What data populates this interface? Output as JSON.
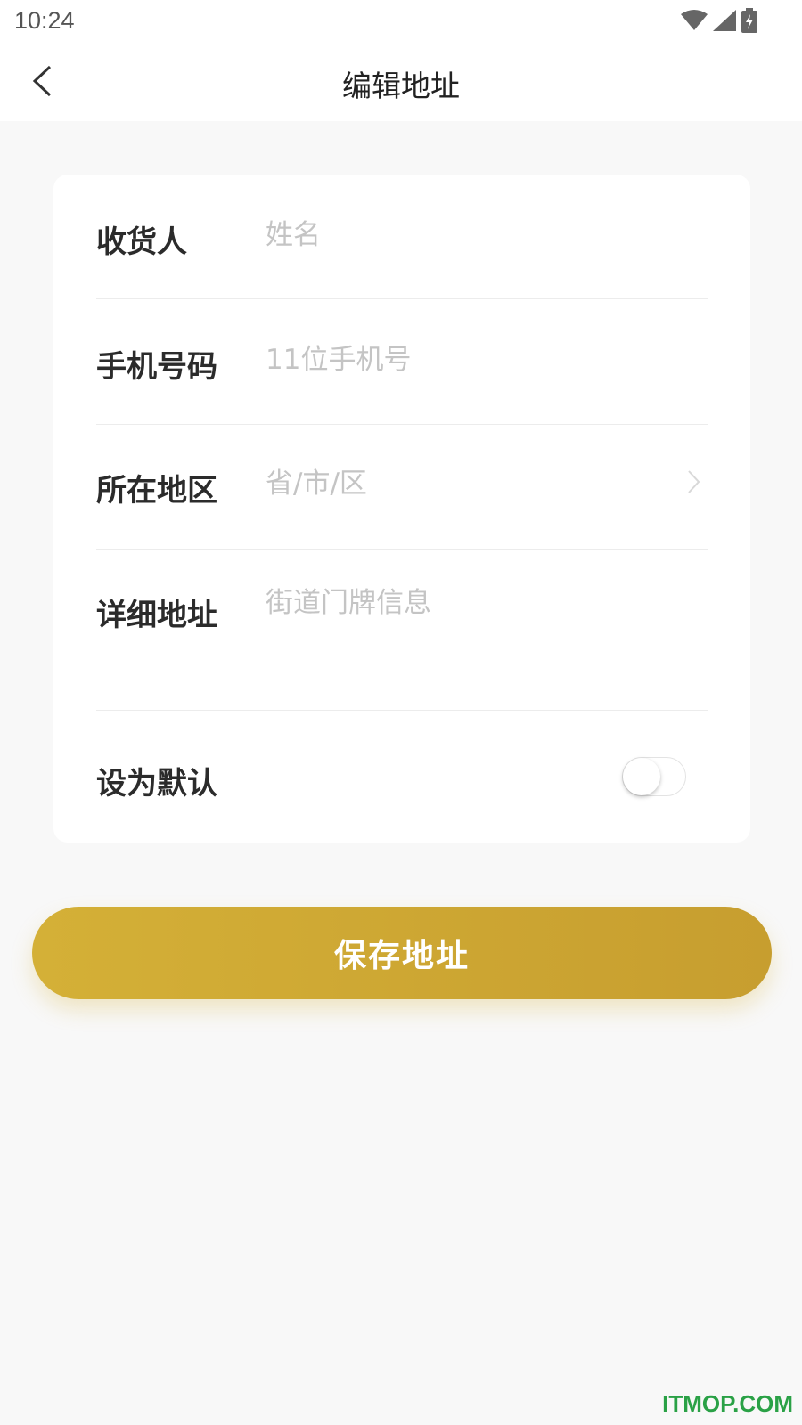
{
  "status_bar": {
    "time": "10:24",
    "icons": [
      "wifi-icon",
      "signal-icon",
      "battery-charging-icon"
    ]
  },
  "nav": {
    "back_icon": "chevron-left-icon",
    "title": "编辑地址"
  },
  "form": {
    "name": {
      "label": "收货人",
      "placeholder": "姓名",
      "value": ""
    },
    "phone": {
      "label": "手机号码",
      "placeholder": "11位手机号",
      "value": ""
    },
    "region": {
      "label": "所在地区",
      "placeholder": "省/市/区",
      "value": "",
      "icon": "chevron-right-icon"
    },
    "address": {
      "label": "详细地址",
      "placeholder": "街道门牌信息",
      "value": ""
    },
    "default": {
      "label": "设为默认",
      "enabled": false
    }
  },
  "save_button": {
    "label": "保存地址"
  },
  "colors": {
    "accent_start": "#d4b037",
    "accent_end": "#c79e2f",
    "background": "#f8f8f8",
    "placeholder": "#c4c4c4"
  },
  "watermark": "ITMOP.COM"
}
